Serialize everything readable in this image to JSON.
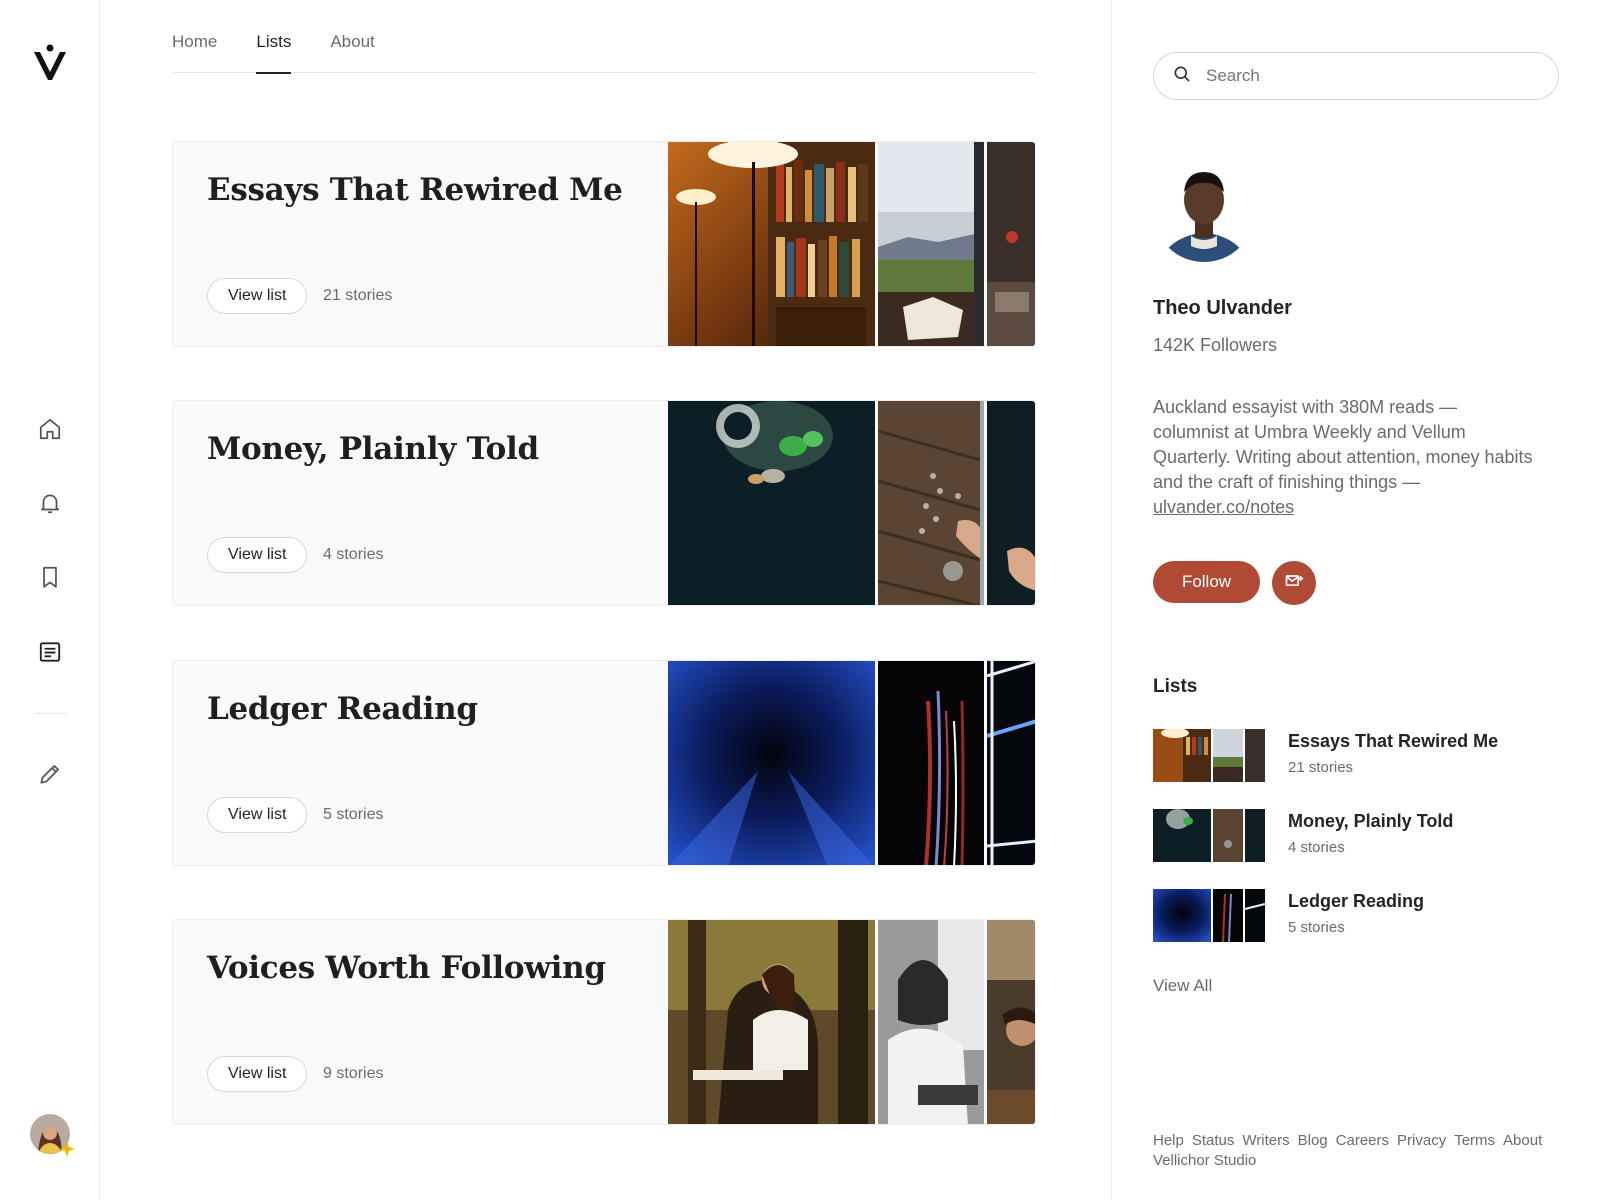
{
  "nav": {
    "logo": "v-logo",
    "icons": [
      "home-icon",
      "bell-icon",
      "bookmark-icon",
      "article-icon",
      "pencil-icon"
    ]
  },
  "tabs": [
    {
      "label": "Home",
      "active": false
    },
    {
      "label": "Lists",
      "active": true
    },
    {
      "label": "About",
      "active": false
    }
  ],
  "lists": [
    {
      "title": "Essays That Rewired Me",
      "button": "View list",
      "count": "21 stories"
    },
    {
      "title": "Money, Plainly Told",
      "button": "View list",
      "count": "4 stories"
    },
    {
      "title": "Ledger Reading",
      "button": "View list",
      "count": "5 stories"
    },
    {
      "title": "Voices Worth Following",
      "button": "View list",
      "count": "9 stories"
    }
  ],
  "sidebar": {
    "search_placeholder": "Search",
    "profile": {
      "name": "Theo Ulvander",
      "followers": "142K Followers",
      "bio": "Auckland essayist with 380M reads — columnist at Umbra Weekly and Vellum Quarterly. Writing about attention, money habits and the craft of finishing things —",
      "link": "ulvander.co/notes",
      "follow_label": "Follow"
    },
    "lists_heading": "Lists",
    "mini_lists": [
      {
        "title": "Essays That Rewired Me",
        "count": "21 stories"
      },
      {
        "title": "Money, Plainly Told",
        "count": "4 stories"
      },
      {
        "title": "Ledger Reading",
        "count": "5 stories"
      }
    ],
    "view_all": "View All",
    "footer": [
      "Help",
      "Status",
      "Writers",
      "Blog",
      "Careers",
      "Privacy",
      "Terms",
      "About",
      "Vellichor Studio"
    ]
  },
  "colors": {
    "accent": "#b04a35",
    "text": "#242424",
    "muted": "#6b6b6b"
  }
}
